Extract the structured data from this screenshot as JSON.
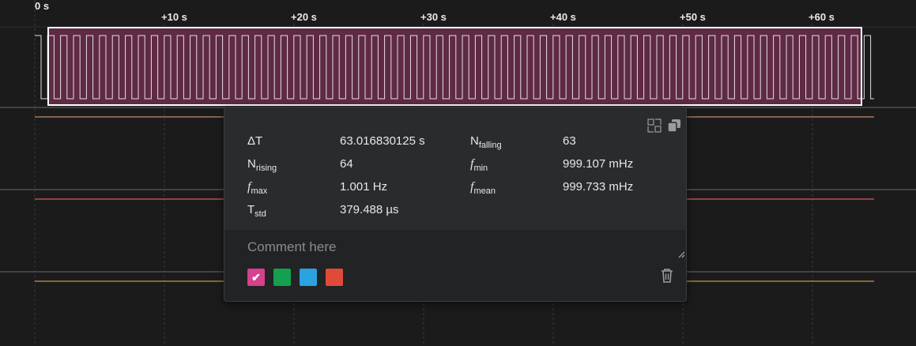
{
  "timeline": {
    "tick_labels": [
      "0 s",
      "+10 s",
      "+20 s",
      "+30 s",
      "+40 s",
      "+50 s",
      "+60 s"
    ],
    "channel_colors": [
      "#ffffff",
      "#e8a87c",
      "#ff6b6b",
      "#f0b34a"
    ],
    "selection_color": "#5e2a44",
    "pulse_count": 64
  },
  "measurement_popup": {
    "metrics": [
      {
        "label_main": "ΔT",
        "label_sub": "",
        "label_italic": false,
        "value": "63.016830125 s"
      },
      {
        "label_main": "N",
        "label_sub": "falling",
        "label_italic": false,
        "value": "63"
      },
      {
        "label_main": "N",
        "label_sub": "rising",
        "label_italic": false,
        "value": "64"
      },
      {
        "label_main": "f",
        "label_sub": "min",
        "label_italic": true,
        "value": "999.107 mHz"
      },
      {
        "label_main": "f",
        "label_sub": "max",
        "label_italic": true,
        "value": "1.001 Hz"
      },
      {
        "label_main": "f",
        "label_sub": "mean",
        "label_italic": true,
        "value": "999.733 mHz"
      },
      {
        "label_main": "T",
        "label_sub": "std",
        "label_italic": false,
        "value": "379.488 µs"
      }
    ],
    "comment": {
      "placeholder": "Comment here",
      "value": ""
    },
    "colors": [
      {
        "name": "pink",
        "hex": "#d7408d",
        "selected": true
      },
      {
        "name": "green",
        "hex": "#14a04e",
        "selected": false
      },
      {
        "name": "blue",
        "hex": "#2aa3e0",
        "selected": false
      },
      {
        "name": "red",
        "hex": "#e04a39",
        "selected": false
      }
    ]
  }
}
